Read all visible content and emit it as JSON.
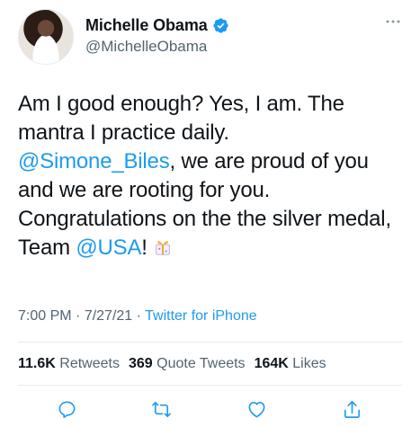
{
  "user": {
    "name": "Michelle Obama",
    "handle": "@MichelleObama"
  },
  "tweet": {
    "line1": "Am I good enough? Yes, I am. The mantra I practice daily.",
    "mention1": "@Simone_Biles",
    "line2": ", we are proud of you and we are rooting for you. Congratulations on the the silver medal, Team ",
    "mention2": "@USA",
    "line3": "!"
  },
  "meta": {
    "time": "7:00 PM",
    "sep1": " · ",
    "date": "7/27/21",
    "sep2": " · ",
    "source": "Twitter for iPhone"
  },
  "stats": {
    "retweets_count": "11.6K",
    "retweets_label": "Retweets",
    "quotes_count": "369",
    "quotes_label": "Quote Tweets",
    "likes_count": "164K",
    "likes_label": "Likes"
  },
  "colors": {
    "accent": "#1d9bf0",
    "text": "#0f1419",
    "muted": "#536471"
  },
  "icons": [
    "verified-badge-icon",
    "more-icon",
    "reply-icon",
    "retweet-icon",
    "like-icon",
    "share-icon",
    "gift-emoji"
  ]
}
